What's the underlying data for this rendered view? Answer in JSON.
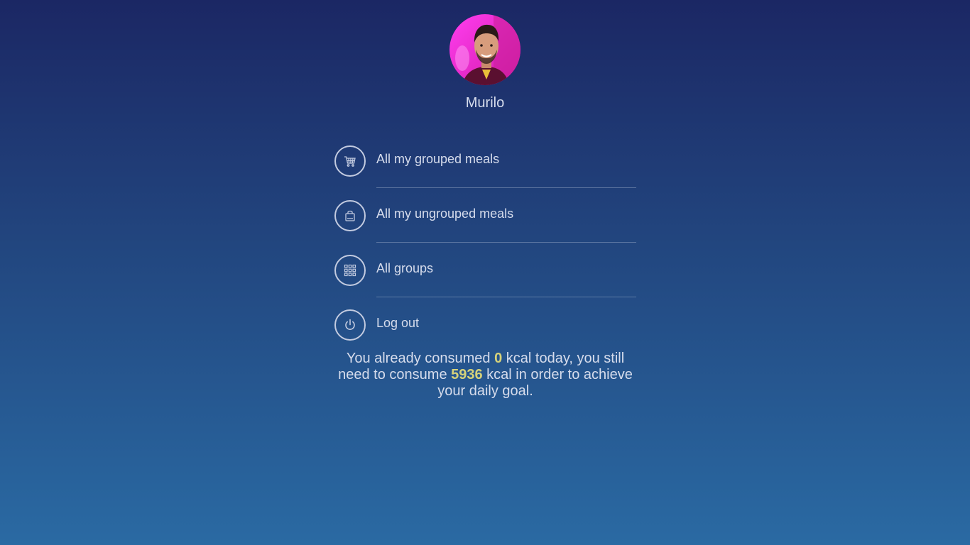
{
  "profile": {
    "name": "Murilo"
  },
  "menu": [
    {
      "label": "All my grouped meals",
      "icon": "cart-icon"
    },
    {
      "label": "All my ungrouped meals",
      "icon": "bag-icon"
    },
    {
      "label": "All groups",
      "icon": "grid-icon"
    },
    {
      "label": "Log out",
      "icon": "power-icon"
    }
  ],
  "summary": {
    "part1": "You already consumed ",
    "consumed": "0",
    "part2": " kcal today, you still need to consume ",
    "remaining": "5936",
    "part3": " kcal in order to achieve your daily goal."
  },
  "colors": {
    "background_top": "#1b2764",
    "background_bottom": "#2a6aa3",
    "text": "#d6dcec",
    "highlight": "#d6d27a",
    "avatar_accent": "#e81ad0"
  }
}
